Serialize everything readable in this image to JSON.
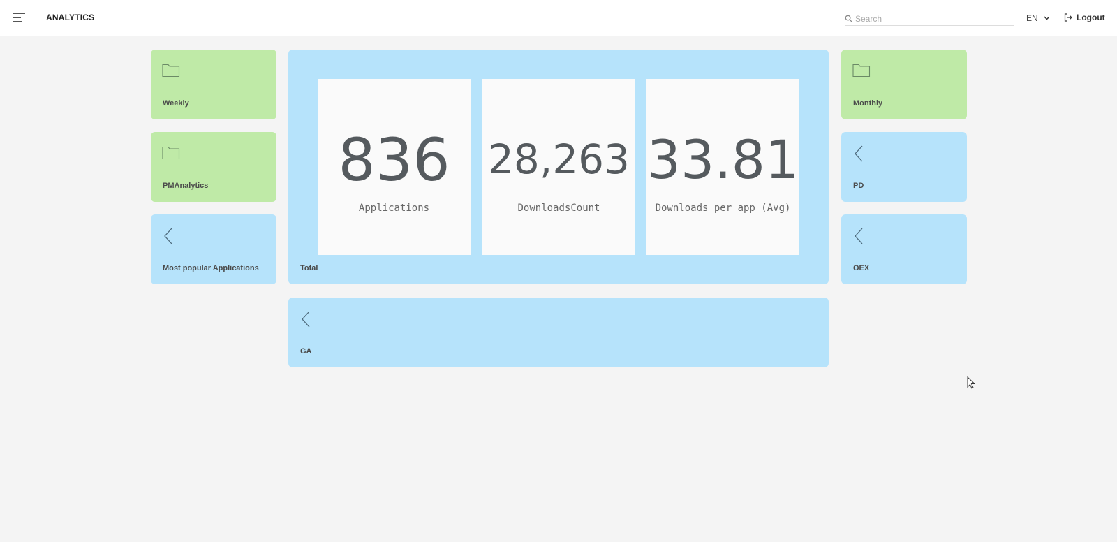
{
  "header": {
    "title": "ANALYTICS",
    "search_placeholder": "Search",
    "language": "EN",
    "logout_label": "Logout"
  },
  "tiles": {
    "weekly": {
      "label": "Weekly",
      "icon": "folder-icon"
    },
    "pmanalytics": {
      "label": "PMAnalytics",
      "icon": "folder-icon"
    },
    "most_popular": {
      "label": "Most popular Applications",
      "icon": "chevron-left-icon"
    },
    "total": {
      "label": "Total"
    },
    "monthly": {
      "label": "Monthly",
      "icon": "folder-icon"
    },
    "pd": {
      "label": "PD",
      "icon": "chevron-left-icon"
    },
    "oex": {
      "label": "OEX",
      "icon": "chevron-left-icon"
    },
    "ga": {
      "label": "GA",
      "icon": "chevron-left-icon"
    }
  },
  "stats": [
    {
      "value": "836",
      "label": "Applications"
    },
    {
      "value": "28,263",
      "label": "DownloadsCount"
    },
    {
      "value": "33.81",
      "label": "Downloads per app (Avg)"
    }
  ],
  "colors": {
    "green_tile": "#bfeaa7",
    "blue_tile": "#b6e3fb",
    "background": "#f4f4f4"
  }
}
